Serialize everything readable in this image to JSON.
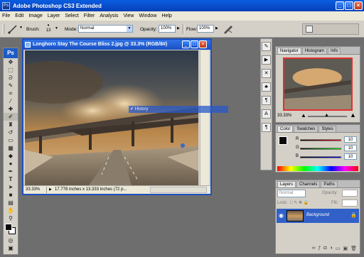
{
  "app": {
    "title": "Adobe Photoshop CS3 Extended"
  },
  "menu": [
    "File",
    "Edit",
    "Image",
    "Layer",
    "Select",
    "Filter",
    "Analysis",
    "View",
    "Window",
    "Help"
  ],
  "options": {
    "brush_label": "Brush:",
    "brush_size": "13",
    "mode_label": "Mode:",
    "mode_value": "Normal",
    "opacity_label": "Opacity:",
    "opacity_value": "100%",
    "flow_label": "Flow:",
    "flow_value": "100%"
  },
  "toolbox": {
    "logo": "Ps"
  },
  "document": {
    "title": "Longhorn Stay The Course Bliss 2.jpg @ 33.3% (RGB/8#)",
    "zoom": "33.33%",
    "doc_info": "17.778 inches x 13.333 inches (72 p..."
  },
  "history_ghost": {
    "label": "History"
  },
  "navigator": {
    "tabs": [
      "Navigator",
      "Histogram",
      "Info"
    ],
    "zoom": "33.33%"
  },
  "color": {
    "tabs": [
      "Color",
      "Swatches",
      "Styles"
    ],
    "channels": [
      {
        "label": "R",
        "value": "10"
      },
      {
        "label": "G",
        "value": "10"
      },
      {
        "label": "B",
        "value": "10"
      }
    ]
  },
  "layers": {
    "tabs": [
      "Layers",
      "Channels",
      "Paths"
    ],
    "blend_mode": "Normal",
    "opacity_label": "Opacity:",
    "fill_label": "Fill:",
    "lock_label": "Lock:",
    "layer_name": "Background"
  }
}
